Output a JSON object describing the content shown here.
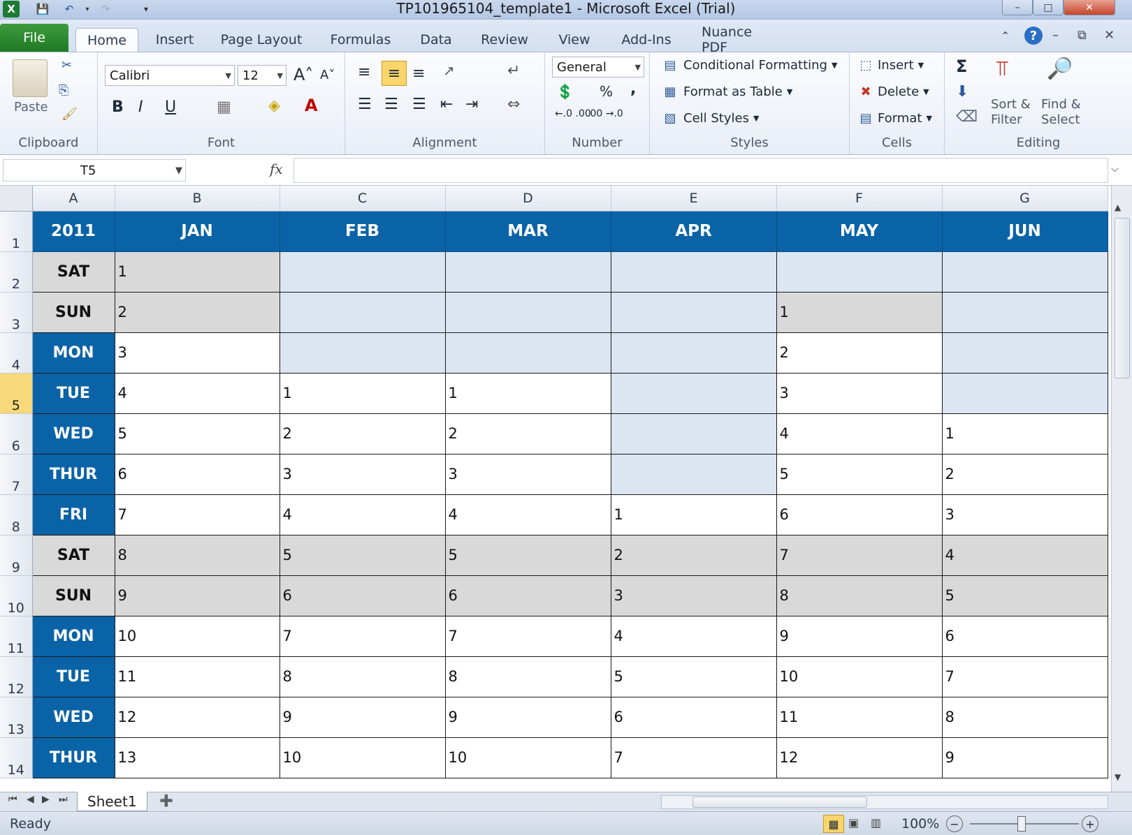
{
  "window": {
    "title": "TP101965104_template1  -  Microsoft Excel (Trial)",
    "minimize_icon": "minimize-icon",
    "maximize_icon": "restore-icon",
    "close_icon": "close-icon"
  },
  "tabs": [
    {
      "label": "File"
    },
    {
      "label": "Home"
    },
    {
      "label": "Insert"
    },
    {
      "label": "Page Layout"
    },
    {
      "label": "Formulas"
    },
    {
      "label": "Data"
    },
    {
      "label": "Review"
    },
    {
      "label": "View"
    },
    {
      "label": "Add-Ins"
    },
    {
      "label": "Nuance PDF"
    }
  ],
  "ribbon": {
    "clipboard": {
      "paste_label": "Paste",
      "group_label": "Clipboard"
    },
    "font": {
      "name": "Calibri",
      "size": "12",
      "bold": "B",
      "italic": "I",
      "underline": "U",
      "group_label": "Font"
    },
    "alignment": {
      "group_label": "Alignment"
    },
    "number": {
      "format": "General",
      "percent": "%",
      "comma": ",",
      "inc_dec": "←.0 .00",
      "dec_dec": ".00 →.0",
      "group_label": "Number"
    },
    "styles": {
      "conditional": "Conditional Formatting",
      "format_table": "Format as Table",
      "cell_styles": "Cell Styles",
      "group_label": "Styles"
    },
    "cells": {
      "insert": "Insert",
      "delete": "Delete",
      "format": "Format",
      "group_label": "Cells"
    },
    "editing": {
      "sigma": "Σ",
      "sort_line1": "Sort &",
      "sort_line2": "Filter",
      "find_line1": "Find &",
      "find_line2": "Select",
      "group_label": "Editing"
    }
  },
  "formula_bar": {
    "name_box": "T5",
    "fx": "fx",
    "formula": ""
  },
  "columns": [
    "A",
    "B",
    "C",
    "D",
    "E",
    "F",
    "G"
  ],
  "header_row": [
    "2011",
    "JAN",
    "FEB",
    "MAR",
    "APR",
    "MAY",
    "JUN"
  ],
  "rows": [
    {
      "num": "2",
      "day": "SAT",
      "cells": [
        "1",
        "",
        "",
        "",
        "",
        ""
      ]
    },
    {
      "num": "3",
      "day": "SUN",
      "cells": [
        "2",
        "",
        "",
        "",
        "1",
        ""
      ]
    },
    {
      "num": "4",
      "day": "MON",
      "cells": [
        "3",
        "",
        "",
        "",
        "2",
        ""
      ]
    },
    {
      "num": "5",
      "day": "TUE",
      "cells": [
        "4",
        "1",
        "1",
        "",
        "3",
        ""
      ]
    },
    {
      "num": "6",
      "day": "WED",
      "cells": [
        "5",
        "2",
        "2",
        "",
        "4",
        "1"
      ]
    },
    {
      "num": "7",
      "day": "THUR",
      "cells": [
        "6",
        "3",
        "3",
        "",
        "5",
        "2"
      ]
    },
    {
      "num": "8",
      "day": "FRI",
      "cells": [
        "7",
        "4",
        "4",
        "1",
        "6",
        "3"
      ]
    },
    {
      "num": "9",
      "day": "SAT",
      "cells": [
        "8",
        "5",
        "5",
        "2",
        "7",
        "4"
      ]
    },
    {
      "num": "10",
      "day": "SUN",
      "cells": [
        "9",
        "6",
        "6",
        "3",
        "8",
        "5"
      ]
    },
    {
      "num": "11",
      "day": "MON",
      "cells": [
        "10",
        "7",
        "7",
        "4",
        "9",
        "6"
      ]
    },
    {
      "num": "12",
      "day": "TUE",
      "cells": [
        "11",
        "8",
        "8",
        "5",
        "10",
        "7"
      ]
    },
    {
      "num": "13",
      "day": "WED",
      "cells": [
        "12",
        "9",
        "9",
        "6",
        "11",
        "8"
      ]
    },
    {
      "num": "14",
      "day": "THUR",
      "cells": [
        "13",
        "10",
        "10",
        "7",
        "12",
        "9"
      ]
    }
  ],
  "sheet_tabs": [
    {
      "label": "Sheet1"
    }
  ],
  "status": {
    "ready": "Ready",
    "zoom": "100%"
  },
  "colors": {
    "header_blue": "#0a63a6",
    "weekend_gray": "#d9d9d9",
    "empty_blue": "#dce6f2",
    "selected_row": "#f7d979"
  }
}
